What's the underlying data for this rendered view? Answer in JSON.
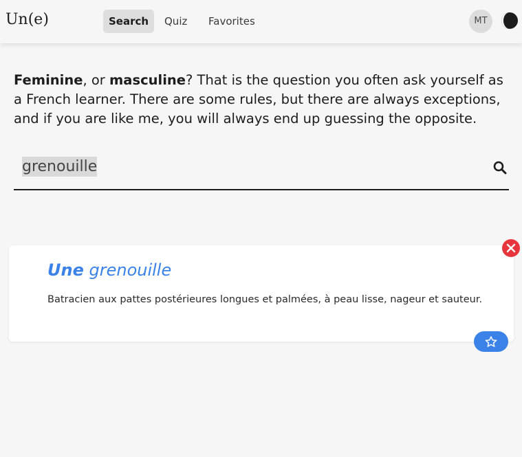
{
  "app": {
    "logo": "Un(e)"
  },
  "nav": {
    "tabs": [
      {
        "label": "Search",
        "active": true
      },
      {
        "label": "Quiz",
        "active": false
      },
      {
        "label": "Favorites",
        "active": false
      }
    ],
    "avatar_initials": "MT"
  },
  "intro": {
    "feminine": "Feminine",
    "or_text": ", or ",
    "masculine": "masculine",
    "rest": "? That is the question you often ask yourself as a French learner. There are some rules, but there are always exceptions, and if you are like me, you will always end up guessing the opposite."
  },
  "search": {
    "value": "grenouille"
  },
  "result": {
    "article": "Une",
    "word": "grenouille",
    "definition": "Batracien aux pattes postérieures longues et palmées, à peau lisse, nageur et sauteur."
  },
  "icons": {
    "theme": "half-moon-icon",
    "search": "magnifier-icon",
    "close": "x-circle-icon",
    "favorite": "star-outline-icon"
  },
  "colors": {
    "accent": "#3b82e8",
    "close": "#e8343c",
    "background": "#f6f6f6"
  }
}
